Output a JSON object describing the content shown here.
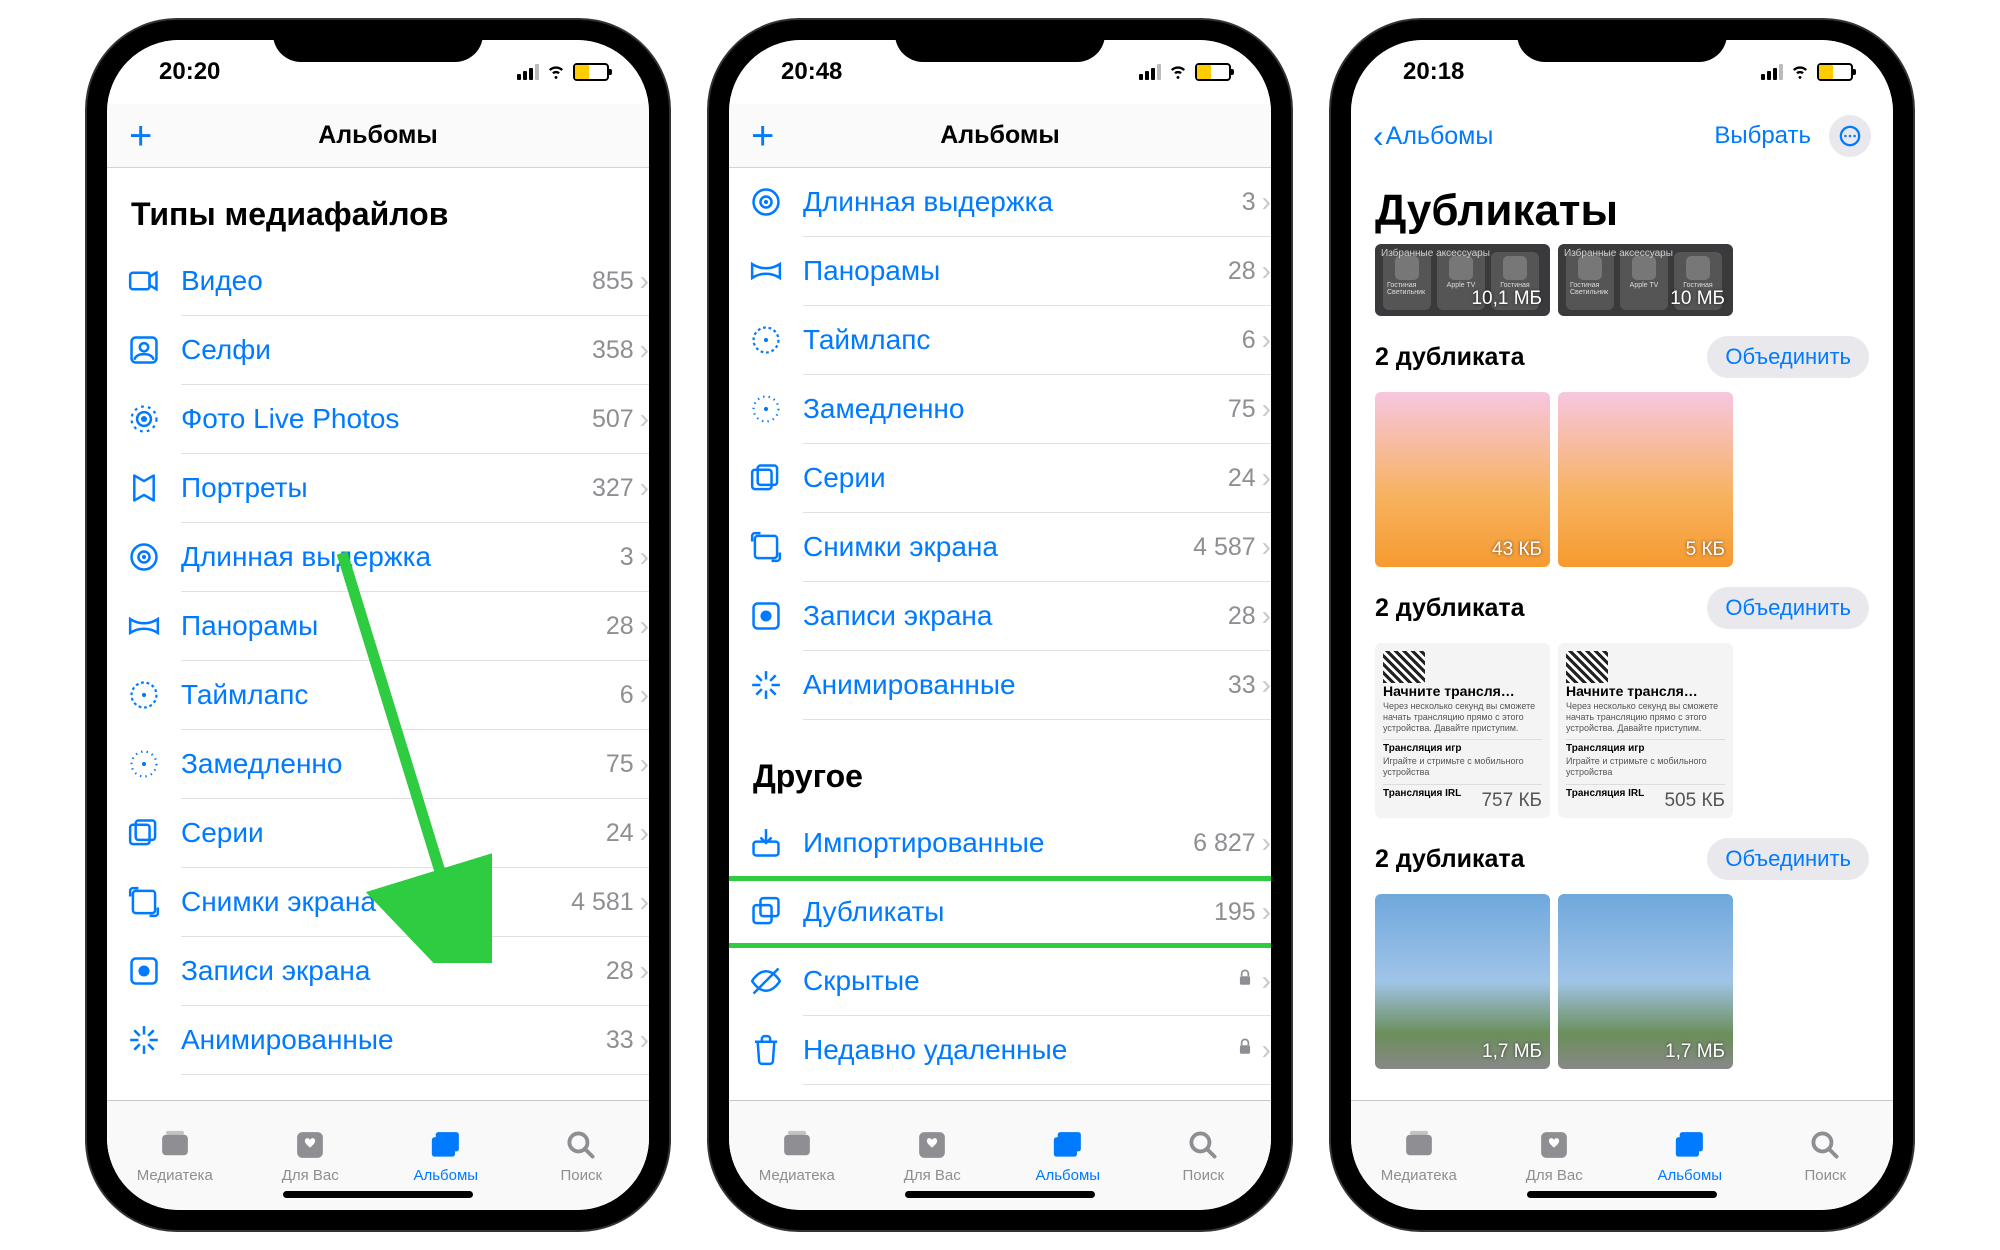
{
  "phones": [
    {
      "time": "20:20",
      "nav": {
        "title": "Альбомы",
        "plus": "+"
      },
      "section": "Типы медиафайлов",
      "rows": [
        {
          "icon": "video",
          "label": "Видео",
          "count": "855"
        },
        {
          "icon": "selfie",
          "label": "Селфи",
          "count": "358"
        },
        {
          "icon": "livephoto",
          "label": "Фото Live Photos",
          "count": "507"
        },
        {
          "icon": "portrait",
          "label": "Портреты",
          "count": "327"
        },
        {
          "icon": "longexp",
          "label": "Длинная выдержка",
          "count": "3"
        },
        {
          "icon": "panorama",
          "label": "Панорамы",
          "count": "28"
        },
        {
          "icon": "timelapse",
          "label": "Таймлапс",
          "count": "6"
        },
        {
          "icon": "slomo",
          "label": "Замедленно",
          "count": "75"
        },
        {
          "icon": "burst",
          "label": "Серии",
          "count": "24"
        },
        {
          "icon": "screenshot",
          "label": "Снимки экрана",
          "count": "4 581"
        },
        {
          "icon": "screenrec",
          "label": "Записи экрана",
          "count": "28"
        },
        {
          "icon": "animated",
          "label": "Анимированные",
          "count": "33"
        }
      ]
    },
    {
      "time": "20:48",
      "nav": {
        "title": "Альбомы",
        "plus": "+"
      },
      "rows_top": [
        {
          "icon": "longexp",
          "label": "Длинная выдержка",
          "count": "3"
        },
        {
          "icon": "panorama",
          "label": "Панорамы",
          "count": "28"
        },
        {
          "icon": "timelapse",
          "label": "Таймлапс",
          "count": "6"
        },
        {
          "icon": "slomo",
          "label": "Замедленно",
          "count": "75"
        },
        {
          "icon": "burst",
          "label": "Серии",
          "count": "24"
        },
        {
          "icon": "screenshot",
          "label": "Снимки экрана",
          "count": "4 587"
        },
        {
          "icon": "screenrec",
          "label": "Записи экрана",
          "count": "28"
        },
        {
          "icon": "animated",
          "label": "Анимированные",
          "count": "33"
        }
      ],
      "section2": "Другое",
      "rows_bot": [
        {
          "icon": "import",
          "label": "Импортированные",
          "count": "6 827"
        },
        {
          "icon": "dup",
          "label": "Дубликаты",
          "count": "195",
          "highlight": true
        },
        {
          "icon": "hidden",
          "label": "Скрытые",
          "lock": true
        },
        {
          "icon": "trash",
          "label": "Недавно удаленные",
          "lock": true
        }
      ]
    },
    {
      "time": "20:18",
      "nav": {
        "back": "Альбомы",
        "select": "Выбрать"
      },
      "title": "Дубликаты",
      "top_strip": {
        "label": "Избранные аксессуары",
        "size1": "10,1 МБ",
        "size2": "10 МБ"
      },
      "groups": [
        {
          "title": "2 дубликата",
          "merge": "Объединить",
          "type": "orange",
          "s1": "43 КБ",
          "s2": "5 КБ"
        },
        {
          "title": "2 дубликата",
          "merge": "Объединить",
          "type": "white",
          "s1": "757 КБ",
          "s2": "505 КБ",
          "tile": {
            "hdr": "Начните трансля…",
            "sub": "Через несколько секунд вы сможете начать трансляцию прямо с этого устройства. Давайте приступим.",
            "b1": "Трансляция игр",
            "b1s": "Играйте и стримьте с мобильного устройства",
            "b2": "Трансляция IRL"
          }
        },
        {
          "title": "2 дубликата",
          "merge": "Объединить",
          "type": "sky",
          "s1": "1,7 МБ",
          "s2": "1,7 МБ"
        }
      ]
    }
  ],
  "tabs": [
    {
      "label": "Медиатека",
      "icon": "library"
    },
    {
      "label": "Для Вас",
      "icon": "foryou"
    },
    {
      "label": "Альбомы",
      "icon": "albums",
      "active": true
    },
    {
      "label": "Поиск",
      "icon": "search"
    }
  ]
}
